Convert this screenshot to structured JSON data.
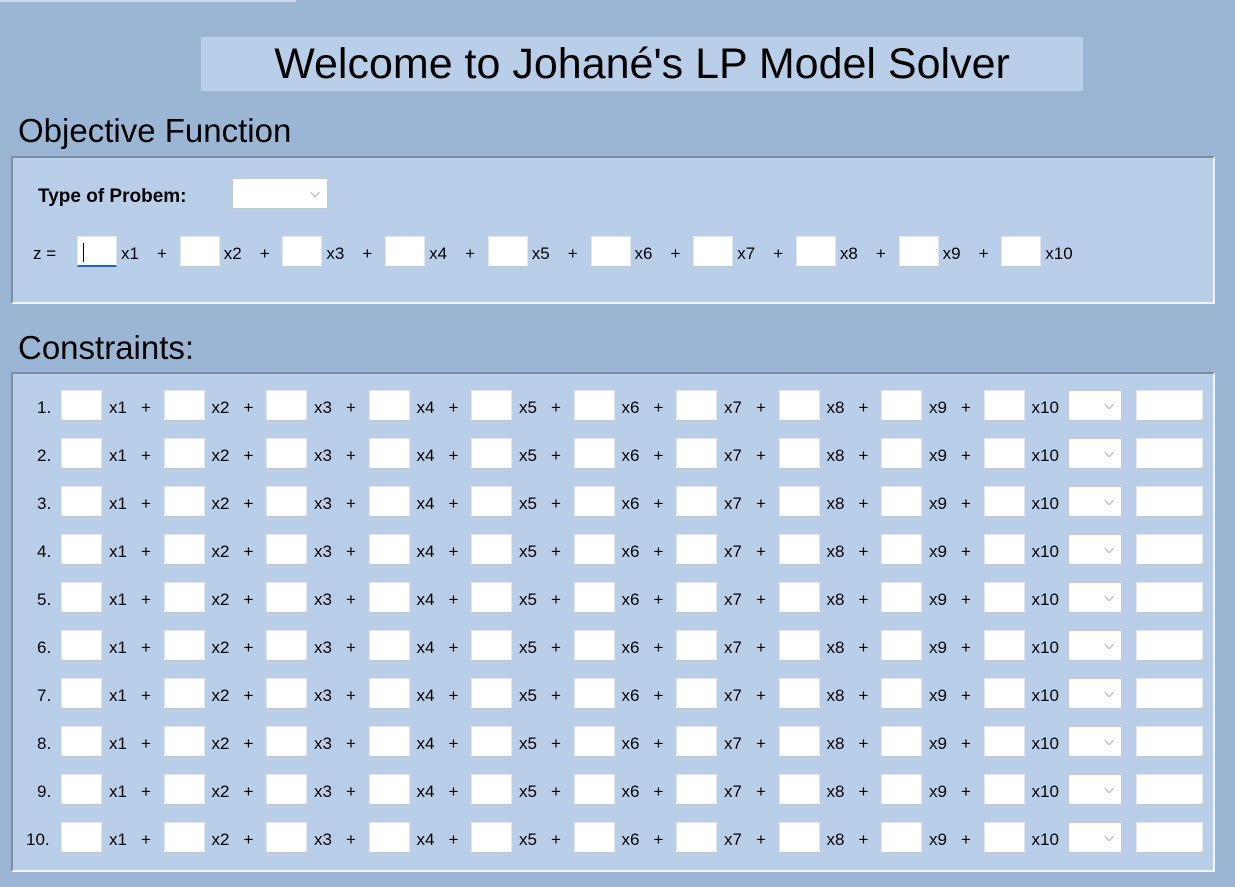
{
  "app": {
    "title": "Welcome to Johané's LP Model Solver"
  },
  "objective": {
    "heading": "Objective Function",
    "type_label": "Type of Probem:",
    "type_value": "",
    "z_label": "z =",
    "plus": "+",
    "variables": [
      "x1",
      "x2",
      "x3",
      "x4",
      "x5",
      "x6",
      "x7",
      "x8",
      "x9",
      "x10"
    ]
  },
  "constraints": {
    "heading": "Constraints:",
    "plus": "+",
    "variables": [
      "x1",
      "x2",
      "x3",
      "x4",
      "x5",
      "x6",
      "x7",
      "x8",
      "x9",
      "x10"
    ],
    "rows": [
      "1.",
      "2.",
      "3.",
      "4.",
      "5.",
      "6.",
      "7.",
      "8.",
      "9.",
      "10."
    ]
  },
  "icons": {
    "dropdown": "chevron-down-icon",
    "dropdown_glyph": "⌵"
  },
  "colors": {
    "background": "#9bb6d4",
    "panel": "#b9cfe9",
    "focus": "#1f64c1"
  }
}
